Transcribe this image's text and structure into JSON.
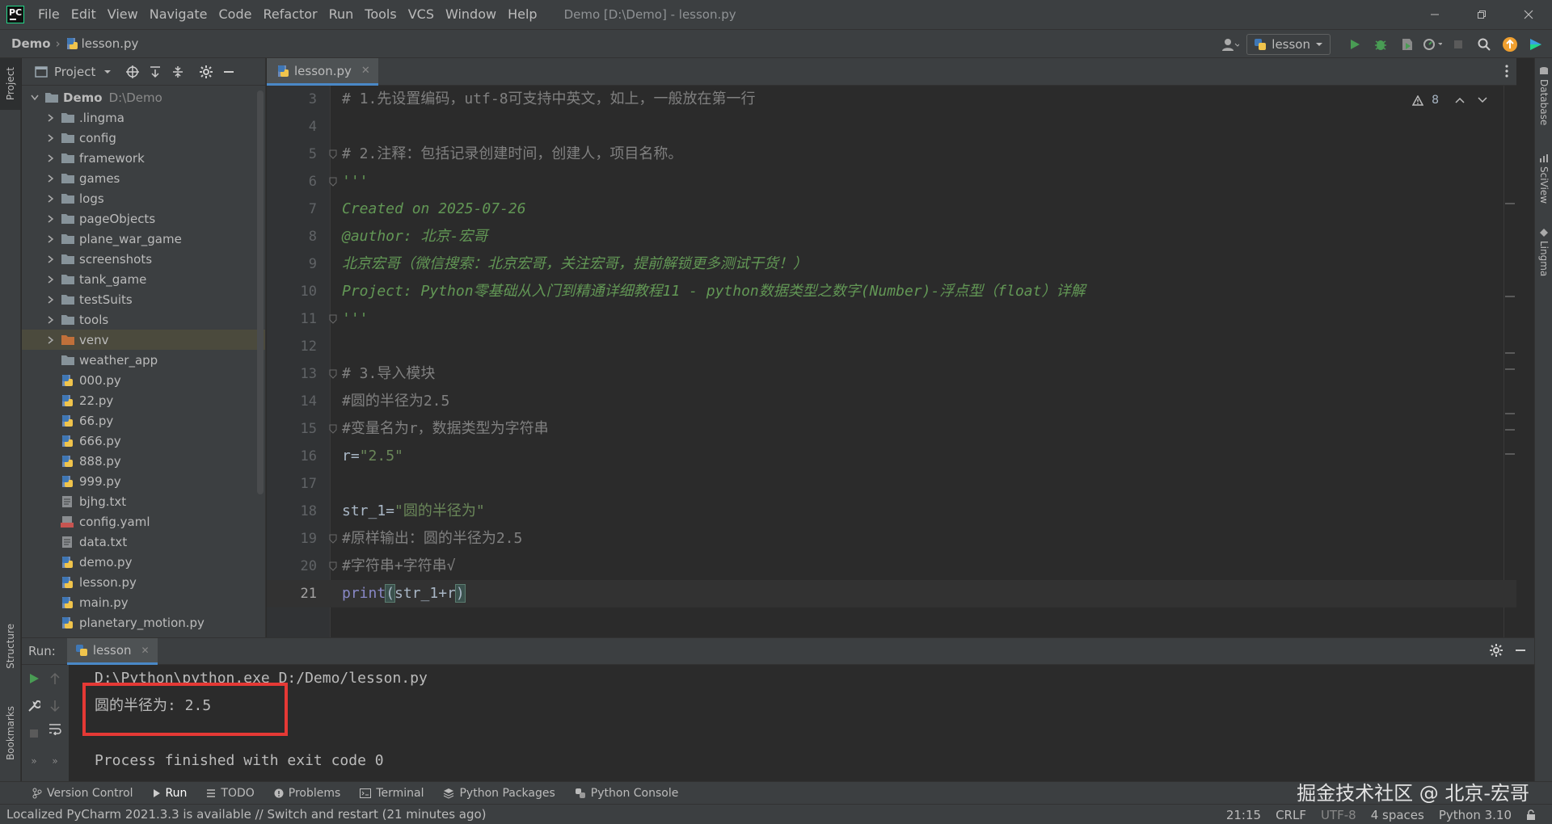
{
  "app": {
    "menu": [
      "File",
      "Edit",
      "View",
      "Navigate",
      "Code",
      "Refactor",
      "Run",
      "Tools",
      "VCS",
      "Window",
      "Help"
    ],
    "window_title": "Demo [D:\\Demo] - lesson.py"
  },
  "nav": {
    "project": "Demo",
    "file": "lesson.py",
    "run_config": "lesson"
  },
  "project_panel": {
    "title": "Project",
    "root": {
      "name": "Demo",
      "path": "D:\\Demo"
    },
    "folders": [
      ".lingma",
      "config",
      "framework",
      "games",
      "logs",
      "pageObjects",
      "plane_war_game",
      "screenshots",
      "tank_game",
      "testSuits",
      "tools",
      "venv",
      "weather_app"
    ],
    "files": [
      "000.py",
      "22.py",
      "66.py",
      "666.py",
      "888.py",
      "999.py",
      "bjhg.txt",
      "config.yaml",
      "data.txt",
      "demo.py",
      "lesson.py",
      "main.py",
      "planetary_motion.py"
    ]
  },
  "editor": {
    "tab": "lesson.py",
    "inspection_count": "8",
    "lines": [
      {
        "n": "3",
        "parts": [
          {
            "t": "# 1.先设置编码，utf-8可支持中英文，如上，一般放在第一行",
            "c": "c-comment"
          }
        ]
      },
      {
        "n": "4",
        "parts": []
      },
      {
        "n": "5",
        "parts": [
          {
            "t": "# 2.注释：包括记录创建时间，创建人，项目名称。",
            "c": "c-comment"
          }
        ]
      },
      {
        "n": "6",
        "parts": [
          {
            "t": "'''",
            "c": "c-doc"
          }
        ]
      },
      {
        "n": "7",
        "parts": [
          {
            "t": "Created on 2025-07-26",
            "c": "c-doc"
          }
        ]
      },
      {
        "n": "8",
        "parts": [
          {
            "t": "@author: 北京-宏哥",
            "c": "c-doc"
          }
        ]
      },
      {
        "n": "9",
        "parts": [
          {
            "t": "北京宏哥（微信搜索：北京宏哥，关注宏哥，提前解锁更多测试干货！）",
            "c": "c-doc"
          }
        ]
      },
      {
        "n": "10",
        "parts": [
          {
            "t": "Project: Python零基础从入门到精通详细教程11 - python数据类型之数字(Number)-浮点型（float）详解",
            "c": "c-doc"
          }
        ]
      },
      {
        "n": "11",
        "parts": [
          {
            "t": "'''",
            "c": "c-doc"
          }
        ]
      },
      {
        "n": "12",
        "parts": []
      },
      {
        "n": "13",
        "parts": [
          {
            "t": "# 3.导入模块",
            "c": "c-comment"
          }
        ]
      },
      {
        "n": "14",
        "parts": [
          {
            "t": "#圆的半径为2.5",
            "c": "c-comment"
          }
        ]
      },
      {
        "n": "15",
        "parts": [
          {
            "t": "#变量名为r，数据类型为字符串",
            "c": "c-comment"
          }
        ]
      },
      {
        "n": "16",
        "parts": [
          {
            "t": "r=",
            "c": "c-plain"
          },
          {
            "t": "\"2.5\"",
            "c": "c-str"
          }
        ]
      },
      {
        "n": "17",
        "parts": []
      },
      {
        "n": "18",
        "parts": [
          {
            "t": "str_1=",
            "c": "c-plain"
          },
          {
            "t": "\"圆的半径为\"",
            "c": "c-str"
          }
        ]
      },
      {
        "n": "19",
        "parts": [
          {
            "t": "#原样输出：圆的半径为2.5",
            "c": "c-comment"
          }
        ]
      },
      {
        "n": "20",
        "parts": [
          {
            "t": "#字符串+字符串√",
            "c": "c-comment"
          }
        ]
      },
      {
        "n": "21",
        "parts": [
          {
            "t": "print",
            "c": "c-builtin"
          },
          {
            "t": "(",
            "c": "c-paren"
          },
          {
            "t": "str_1+r",
            "c": "c-plain"
          },
          {
            "t": ")",
            "c": "c-paren"
          }
        ]
      }
    ]
  },
  "run": {
    "label": "Run:",
    "tab": "lesson",
    "output": [
      "D:\\Python\\python.exe D:/Demo/lesson.py",
      "圆的半径为: 2.5",
      "",
      "Process finished with exit code 0"
    ]
  },
  "tool_windows": [
    "Version Control",
    "Run",
    "TODO",
    "Problems",
    "Terminal",
    "Python Packages",
    "Python Console"
  ],
  "left_strip": {
    "project": "Project",
    "structure": "Structure",
    "bookmarks": "Bookmarks"
  },
  "right_strip": {
    "database": "Database",
    "sciview": "SciView",
    "lingma": "Lingma"
  },
  "status": {
    "message": "Localized PyCharm 2021.3.3 is available // Switch and restart (21 minutes ago)",
    "position": "21:15",
    "line_sep": "CRLF",
    "encoding": "UTF-8",
    "indent": "4 spaces",
    "interpreter": "Python 3.10"
  },
  "watermark": "掘金技术社区 @ 北京-宏哥",
  "colors": {
    "accent": "#4a88c7",
    "run_green": "#499c54",
    "highlight_red": "#e53935"
  }
}
